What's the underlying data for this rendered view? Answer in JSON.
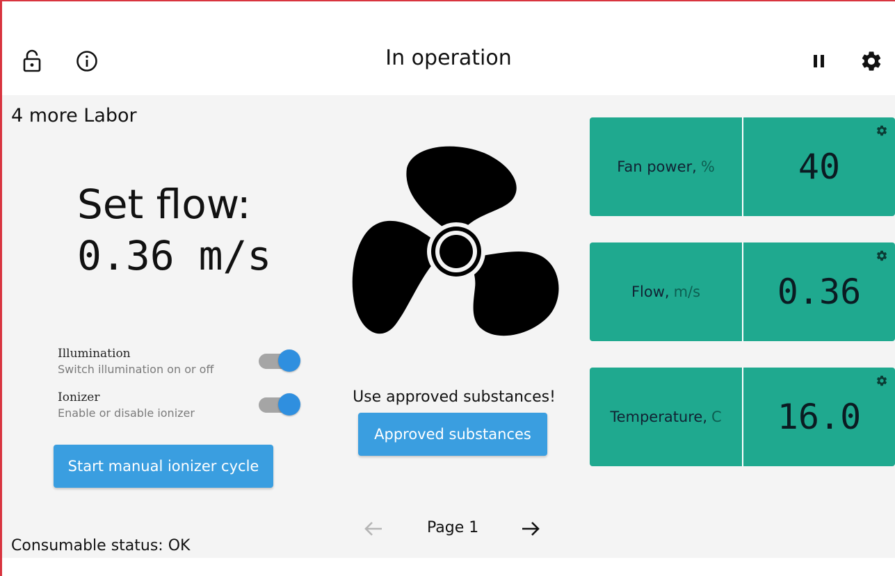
{
  "header": {
    "title": "In operation",
    "icons": {
      "lock": "lock-icon",
      "info": "info-icon",
      "pause": "pause-icon",
      "settings": "gear-icon"
    }
  },
  "main": {
    "site_name": "4 more Labor",
    "set_flow_label": "Set flow:",
    "set_flow_value": "0.36 m/s",
    "toggles": [
      {
        "title": "Illumination",
        "subtitle": "Switch illumination on or off",
        "on": true
      },
      {
        "title": "Ionizer",
        "subtitle": "Enable or disable ionizer",
        "on": true
      }
    ],
    "manual_ionizer_button": "Start manual ionizer cycle",
    "warning": "Use approved substances!",
    "approved_button": "Approved substances",
    "status": "Consumable status: OK"
  },
  "tiles": [
    {
      "label": "Fan power,",
      "unit": "%",
      "value": "40"
    },
    {
      "label": "Flow,",
      "unit": "m/s",
      "value": "0.36"
    },
    {
      "label": "Temperature,",
      "unit": "C",
      "value": "16.0"
    }
  ],
  "pagination": {
    "page_label": "Page 1"
  },
  "colors": {
    "accent_red": "#d8343f",
    "tile_green": "#1fa98f",
    "button_blue": "#3a9ee0",
    "toggle_blue": "#2f8fdf"
  }
}
